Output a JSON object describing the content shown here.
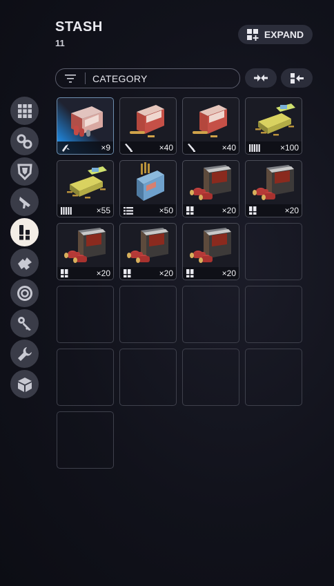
{
  "header": {
    "title": "STASH",
    "count": "11"
  },
  "expand_button": {
    "label": "EXPAND",
    "icon": "grid-plus-icon"
  },
  "filter": {
    "label": "CATEGORY",
    "icon": "filter-icon"
  },
  "toolbar": {
    "compact_icon": "collapse-arrows-icon",
    "sort_icon": "sort-into-icon"
  },
  "sidebar": {
    "items": [
      {
        "icon": "all-items-grid-icon",
        "active": false
      },
      {
        "icon": "gear-parts-icon",
        "active": false
      },
      {
        "icon": "armor-icon",
        "active": false
      },
      {
        "icon": "weapon-icon",
        "active": false
      },
      {
        "icon": "ammo-icon",
        "active": true
      },
      {
        "icon": "attachment-icon",
        "active": false
      },
      {
        "icon": "container-icon",
        "active": false
      },
      {
        "icon": "key-icon",
        "active": false
      },
      {
        "icon": "tools-icon",
        "active": false
      },
      {
        "icon": "crate-icon",
        "active": false
      }
    ]
  },
  "items": [
    {
      "type": "rocket",
      "qty": "×9",
      "art": "pink-ammo-box",
      "selected": true
    },
    {
      "type": "rifle",
      "qty": "×40",
      "art": "red-ammo-box",
      "selected": false
    },
    {
      "type": "rifle",
      "qty": "×40",
      "art": "red-ammo-box",
      "selected": false
    },
    {
      "type": "multi",
      "qty": "×100",
      "art": "yellow-ammo-box",
      "selected": false
    },
    {
      "type": "multi",
      "qty": "×55",
      "art": "yellow-ammo-box",
      "selected": false
    },
    {
      "type": "stack",
      "qty": "×50",
      "art": "blue-ammo-box",
      "selected": false
    },
    {
      "type": "shell",
      "qty": "×20",
      "art": "shotgun-crate",
      "selected": false
    },
    {
      "type": "shell",
      "qty": "×20",
      "art": "shotgun-crate",
      "selected": false
    },
    {
      "type": "shell",
      "qty": "×20",
      "art": "shotgun-crate",
      "selected": false
    },
    {
      "type": "shell",
      "qty": "×20",
      "art": "shotgun-crate",
      "selected": false
    },
    {
      "type": "shell",
      "qty": "×20",
      "art": "shotgun-crate",
      "selected": false
    }
  ],
  "empty_slots": 10
}
